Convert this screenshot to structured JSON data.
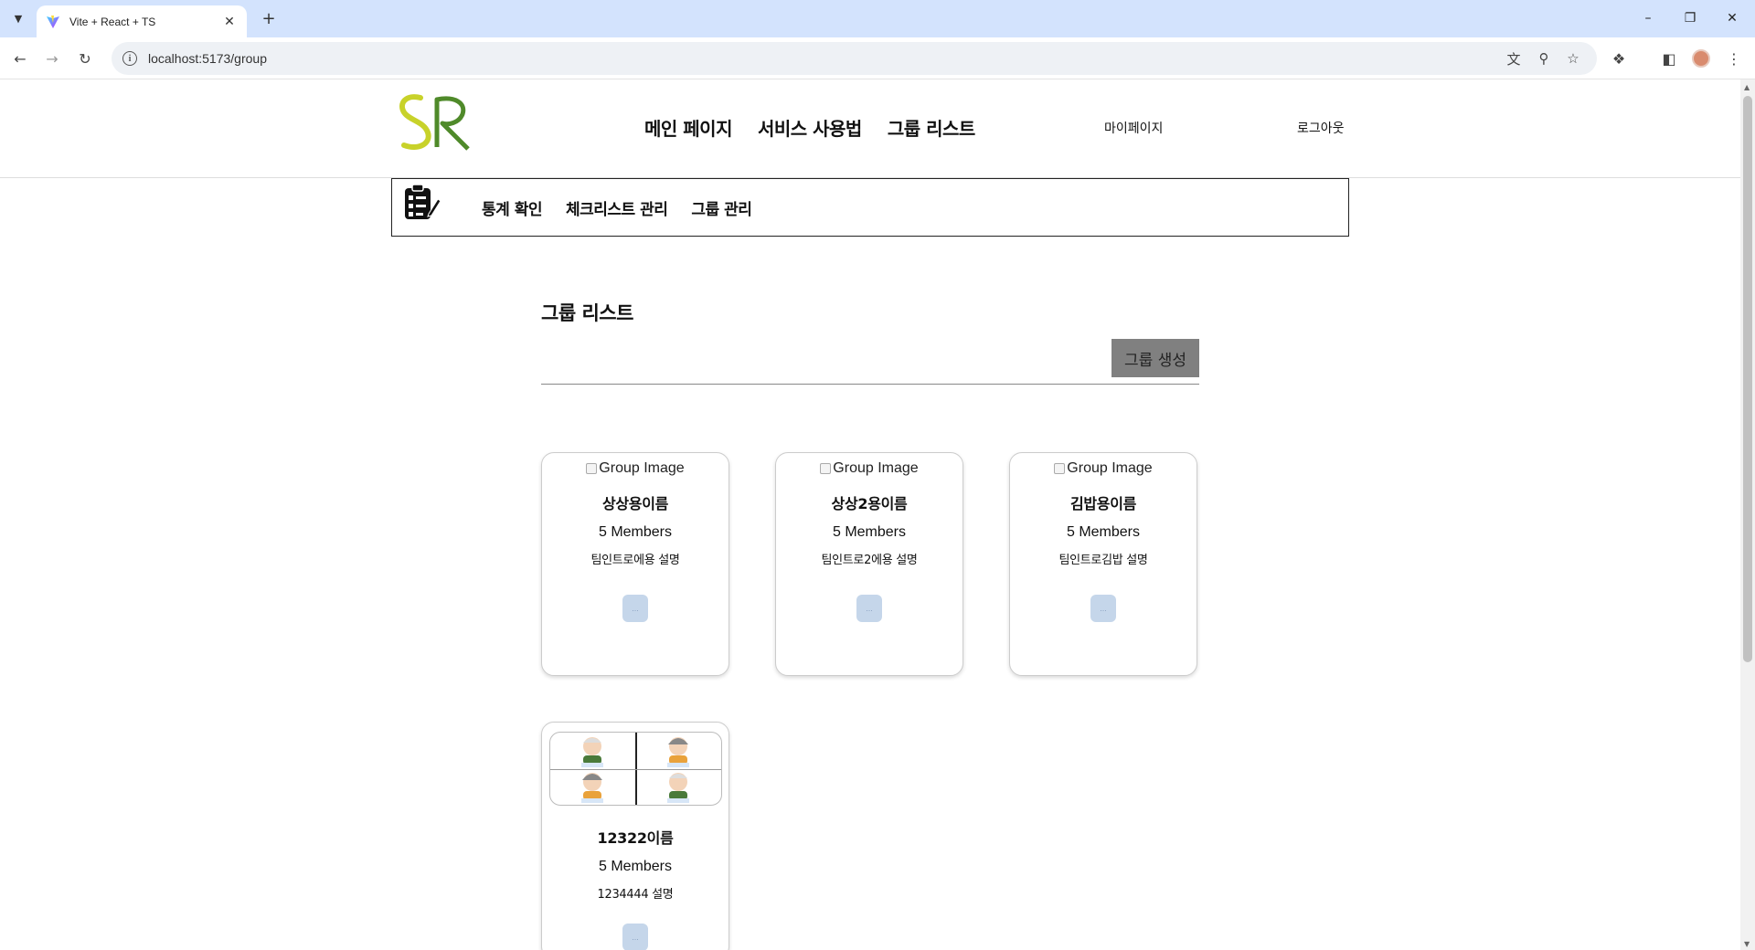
{
  "browser": {
    "tab_title": "Vite + React + TS",
    "url": "localhost:5173/group",
    "icons": [
      "tab-search-icon",
      "vite-favicon",
      "close-icon",
      "new-tab-icon",
      "minimize-icon",
      "restore-icon",
      "window-close-icon",
      "back-icon",
      "forward-icon",
      "reload-icon",
      "site-info-icon",
      "translate-icon",
      "zoom-icon",
      "bookmark-star-icon",
      "extensions-icon",
      "side-panel-icon",
      "profile-avatar",
      "menu-kebab-icon"
    ]
  },
  "header": {
    "logo_text": "SR",
    "nav": [
      "메인 페이지",
      "서비스 사용법",
      "그룹 리스트"
    ],
    "mypage": "마이페이지",
    "logout": "로그아웃"
  },
  "subnav": {
    "links": [
      "통계 확인",
      "체크리스트 관리",
      "그룹 관리"
    ]
  },
  "main": {
    "title": "그룹 리스트",
    "create_button": "그룹 생성",
    "cards": [
      {
        "image_alt": "Group Image",
        "name": "상상용이름",
        "members": "5 Members",
        "description": "팀인트로에용 설명",
        "button": "..."
      },
      {
        "image_alt": "Group Image",
        "name": "상상2용이름",
        "members": "5 Members",
        "description": "팀인트로2에용 설명",
        "button": "..."
      },
      {
        "image_alt": "Group Image",
        "name": "김밥용이름",
        "members": "5 Members",
        "description": "팀인트로김밥 설명",
        "button": "..."
      },
      {
        "image_alt": "",
        "name": "12322이름",
        "members": "5 Members",
        "description": "1234444 설명",
        "button": "..."
      }
    ]
  },
  "colors": {
    "tabbar_bg": "#d3e3fd",
    "logo_s": "#c8d22a",
    "logo_r": "#4f8a2a",
    "create_btn_bg": "#808080",
    "card_btn_bg": "#c5d6ea"
  }
}
